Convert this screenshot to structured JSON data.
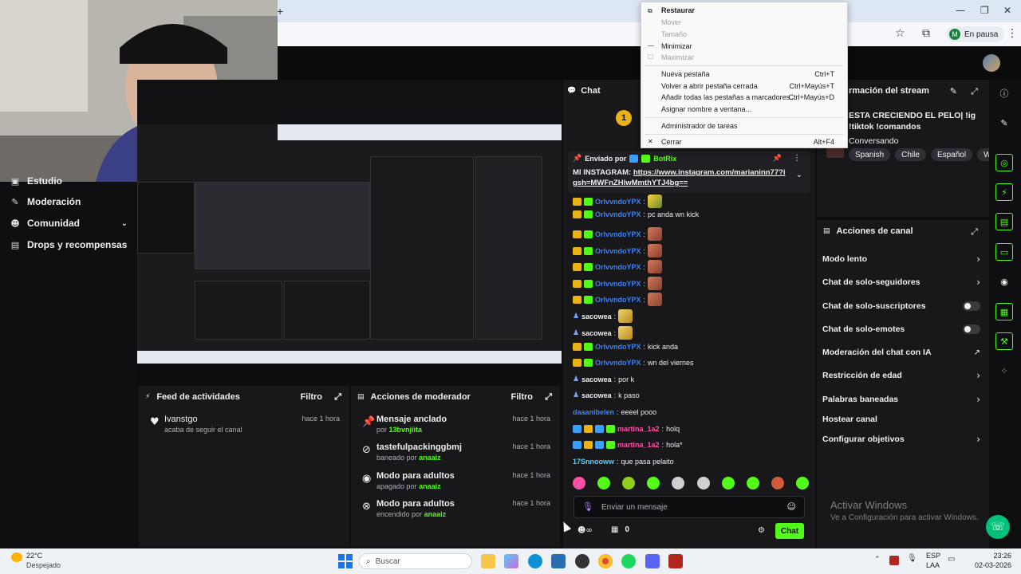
{
  "browser": {
    "pause_label": "En pausa",
    "profile_initial": "M"
  },
  "context_menu": {
    "items": [
      {
        "label": "Restaurar",
        "shortcut": "",
        "disabled": false,
        "icon": "restore-icon"
      },
      {
        "label": "Mover",
        "shortcut": "",
        "disabled": true,
        "icon": ""
      },
      {
        "label": "Tamaño",
        "shortcut": "",
        "disabled": true,
        "icon": ""
      },
      {
        "label": "Minimizar",
        "shortcut": "",
        "disabled": false,
        "icon": "minimize-icon"
      },
      {
        "label": "Maximizar",
        "shortcut": "",
        "disabled": true,
        "icon": "maximize-icon"
      },
      {
        "label": "Nueva pestaña",
        "shortcut": "Ctrl+T",
        "disabled": false,
        "icon": ""
      },
      {
        "label": "Volver a abrir pestaña cerrada",
        "shortcut": "Ctrl+Mayús+T",
        "disabled": false,
        "icon": ""
      },
      {
        "label": "Añadir todas las pestañas a marcadores...",
        "shortcut": "Ctrl+Mayús+D",
        "disabled": false,
        "icon": ""
      },
      {
        "label": "Asignar nombre a ventana...",
        "shortcut": "",
        "disabled": false,
        "icon": ""
      },
      {
        "label": "Administrador de tareas",
        "shortcut": "",
        "disabled": false,
        "icon": ""
      },
      {
        "label": "Cerrar",
        "shortcut": "Alt+F4",
        "disabled": false,
        "icon": "close-icon"
      }
    ]
  },
  "sidebar": {
    "items": [
      {
        "label": "Estudio",
        "icon": "studio-icon"
      },
      {
        "label": "Moderación",
        "icon": "wrench-icon"
      },
      {
        "label": "Comunidad",
        "icon": "community-icon"
      },
      {
        "label": "Drops y recompensas",
        "icon": "drops-icon"
      }
    ]
  },
  "feed": {
    "title": "Feed de actividades",
    "filter": "Filtro",
    "rows": [
      {
        "user": "Ivanstgo",
        "detail": "acaba de seguir el canal",
        "time": "hace 1 hora"
      }
    ]
  },
  "mod_actions": {
    "title": "Acciones de moderador",
    "filter": "Filtro",
    "rows": [
      {
        "title": "Mensaje anclado",
        "prefix": "por",
        "user": "13bvnjiita",
        "suffix": "",
        "time": "hace 1 hora",
        "icon": "pin-icon"
      },
      {
        "title": "tastefulpackinggbmj",
        "prefix": "baneado por",
        "user": "anaaiz",
        "suffix": "",
        "time": "hace 1 hora",
        "icon": "ban-icon"
      },
      {
        "title": "Modo para adultos",
        "prefix": "apagado por",
        "user": "anaaiz",
        "suffix": "",
        "time": "hace 1 hora",
        "icon": "eye-icon"
      },
      {
        "title": "Modo para adultos",
        "prefix": "encendido por",
        "user": "anaaiz",
        "suffix": "",
        "time": "hace 1 hora",
        "icon": "eye-off-icon"
      }
    ]
  },
  "chat": {
    "title": "Chat",
    "pinned": {
      "label": "Enviado por",
      "user": "BotRix",
      "text": "MI INSTAGRAM: ",
      "link": "https://www.instagram.com/marianinn77?igsh=MWFnZHlwMmthYTJ4bg=="
    },
    "messages": [
      {
        "user": "OrlvvndoYPX",
        "text": "",
        "color": "blue",
        "emote": "car"
      },
      {
        "user": "OrlvvndoYPX",
        "text": "pc anda wn kick",
        "color": "blue",
        "emote": ""
      },
      {
        "user": "OrlvvndoYPX",
        "text": "",
        "color": "blue",
        "emote": "face"
      },
      {
        "user": "OrlvvndoYPX",
        "text": "",
        "color": "blue",
        "emote": "face"
      },
      {
        "user": "OrlvvndoYPX",
        "text": "",
        "color": "blue",
        "emote": "face"
      },
      {
        "user": "OrlvvndoYPX",
        "text": "",
        "color": "blue",
        "emote": "face"
      },
      {
        "user": "OrlvvndoYPX",
        "text": "",
        "color": "blue",
        "emote": "face"
      },
      {
        "user": "sacowea",
        "text": "",
        "color": "white",
        "emote": "gold"
      },
      {
        "user": "sacowea",
        "text": "",
        "color": "white",
        "emote": "gold"
      },
      {
        "user": "OrlvvndoYPX",
        "text": "kick anda",
        "color": "blue",
        "emote": ""
      },
      {
        "user": "OrlvvndoYPX",
        "text": "wn del viernes",
        "color": "blue",
        "emote": ""
      },
      {
        "user": "sacowea",
        "text": "por k",
        "color": "white",
        "emote": ""
      },
      {
        "user": "sacowea",
        "text": "k paso",
        "color": "white",
        "emote": ""
      },
      {
        "user": "daaanibelen",
        "text": "eeeel pooo",
        "color": "blue",
        "emote": ""
      },
      {
        "user": "martina_1a2",
        "text": "holq",
        "color": "pink",
        "emote": ""
      },
      {
        "user": "martina_1a2",
        "text": "hola*",
        "color": "pink",
        "emote": ""
      },
      {
        "user": "17Snnooww",
        "text": "que pasa pelaito",
        "color": "teal",
        "emote": ""
      }
    ],
    "input_placeholder": "Enviar un mensaje",
    "points": "0",
    "send_label": "Chat"
  },
  "stream_info": {
    "title": "rmación del stream",
    "stream_title": "ESTA CRECIENDO EL PELO| !ig !tiktok !comandos",
    "category": "Conversando",
    "tags": [
      "Spanish",
      "Chile",
      "Español",
      "Wa"
    ]
  },
  "channel_actions": {
    "title": "Acciones de canal",
    "rows": [
      {
        "label": "Modo lento",
        "control": "chevron"
      },
      {
        "label": "Chat de solo-seguidores",
        "control": "chevron"
      },
      {
        "label": "Chat de solo-suscriptores",
        "control": "toggle"
      },
      {
        "label": "Chat de solo-emotes",
        "control": "toggle"
      },
      {
        "label": "Moderación del chat con IA",
        "control": "external"
      },
      {
        "label": "Restricción de edad",
        "control": "chevron"
      },
      {
        "label": "Palabras baneadas",
        "control": "chevron"
      },
      {
        "label": "Hostear canal",
        "control": ""
      },
      {
        "label": "Configurar objetivos",
        "control": "chevron"
      }
    ]
  },
  "watermark": {
    "title": "Activar Windows",
    "subtitle": "Ve a Configuración para activar Windows."
  },
  "taskbar": {
    "weather_temp": "22°C",
    "weather_desc": "Despejado",
    "search_placeholder": "Buscar",
    "lang": "ESP",
    "lang_sub": "LAA",
    "time": "23:26",
    "date": "02-03-2026"
  },
  "colors": {
    "accent": "#53fc18",
    "bg": "#0e0e10",
    "panel": "#18181b"
  }
}
